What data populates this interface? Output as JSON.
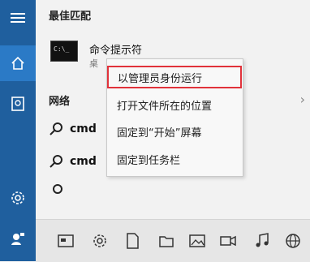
{
  "section": {
    "best_match": "最佳匹配",
    "web": "网络"
  },
  "best": {
    "title": "命令提示符",
    "subtitle": "桌"
  },
  "results": [
    {
      "text": "cmd"
    },
    {
      "text": "cmd"
    }
  ],
  "context_menu": [
    {
      "label": "以管理员身份运行",
      "highlighted": true
    },
    {
      "label": "打开文件所在的位置"
    },
    {
      "label": "固定到“开始”屏幕"
    },
    {
      "label": "固定到任务栏"
    }
  ],
  "colors": {
    "rail": "#1f5f9e",
    "highlight": "#e1323a"
  },
  "icons": {
    "rail": [
      "hamburger-icon",
      "home-icon",
      "notebook-icon",
      "settings-icon",
      "user-feedback-icon"
    ],
    "taskbar": [
      "tablet-icon",
      "settings-icon",
      "document-icon",
      "folder-icon",
      "photo-icon",
      "video-icon",
      "music-icon",
      "web-icon"
    ]
  }
}
